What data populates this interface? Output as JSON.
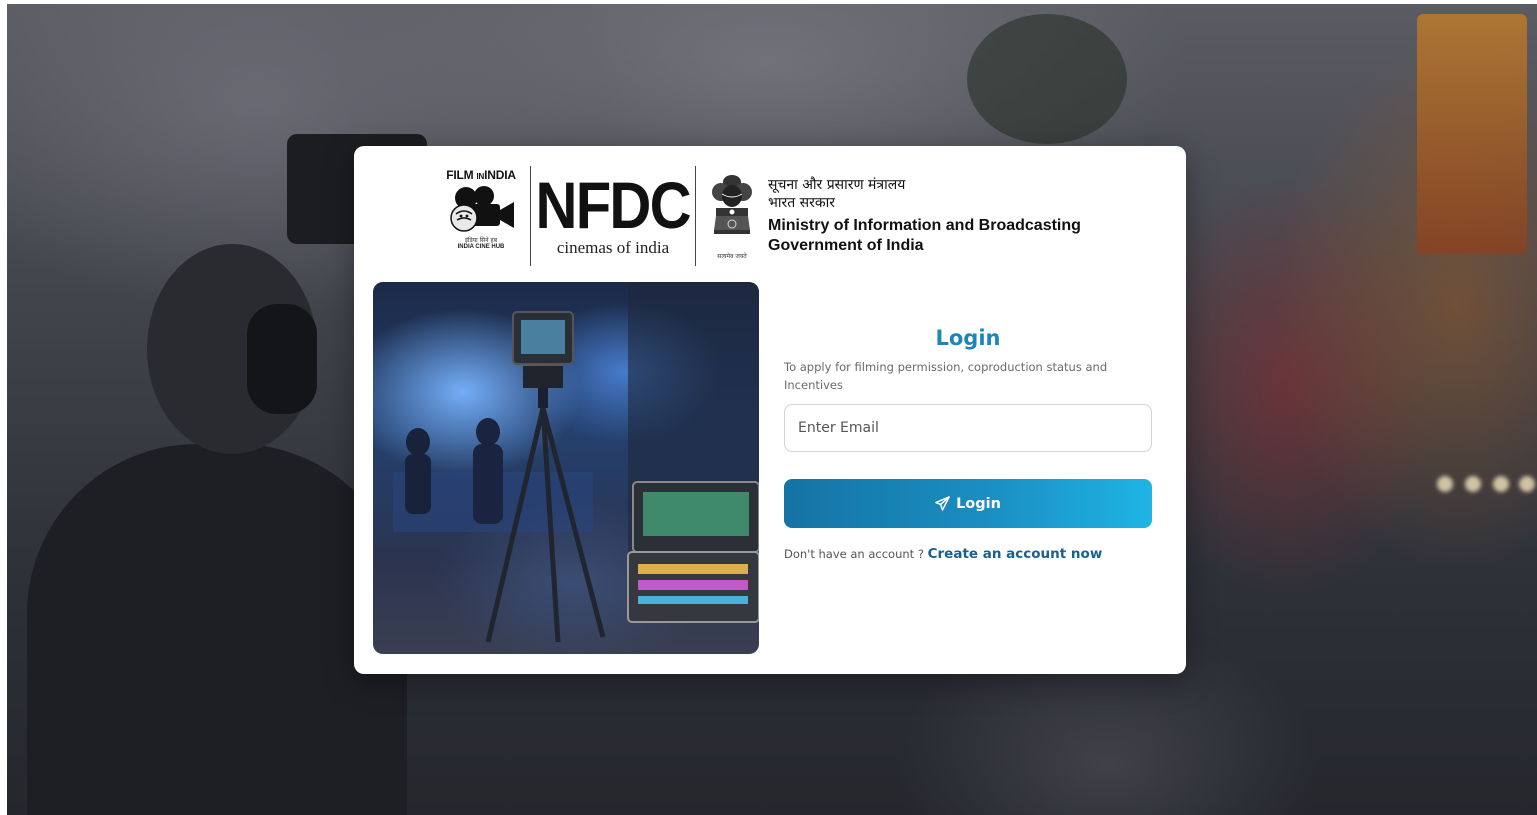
{
  "header": {
    "film_logo": {
      "title_main": "FILM",
      "title_small": "IN",
      "title_end": "INDIA",
      "hindi_line": "इंडिया सिने हब",
      "sub_line": "INDIA CINE HUB"
    },
    "nfdc_logo": {
      "mark": "NFDC",
      "tagline": "cinemas of india"
    },
    "emblem": {
      "motto": "सत्यमेव जयते"
    },
    "ministry": {
      "hindi_line1": "सूचना और प्रसारण मंत्रालय",
      "hindi_line2": "भारत सरकार",
      "english_line1": "Ministry of Information and Broadcasting",
      "english_line2": "Government of India"
    }
  },
  "login": {
    "title": "Login",
    "subtitle": "To apply for filming permission, coproduction status and Incentives",
    "email_placeholder": "Enter Email",
    "email_value": "",
    "button_label": "Login",
    "button_icon": "send-icon",
    "signup_prompt": "Don't have an account ?",
    "signup_link": "Create an account now"
  },
  "colors": {
    "accent": "#1b86b8",
    "button_start": "#1474a4",
    "button_end": "#1fb4e4",
    "link": "#17618f"
  }
}
